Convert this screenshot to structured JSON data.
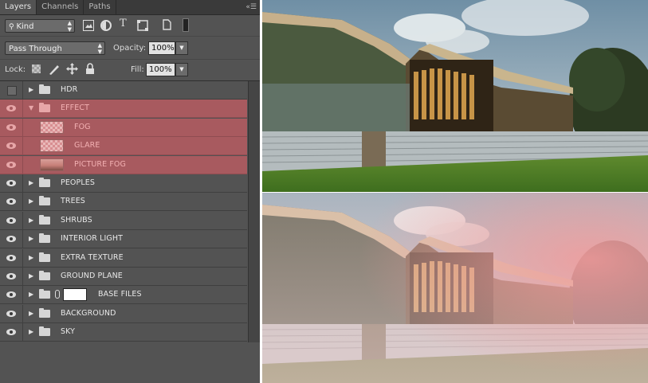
{
  "tabs": [
    {
      "label": "Layers",
      "active": true
    },
    {
      "label": "Channels",
      "active": false
    },
    {
      "label": "Paths",
      "active": false
    }
  ],
  "filter": {
    "kind_label": "Kind",
    "icons": [
      "image-filter-icon",
      "adjustment-filter-icon",
      "type-filter-icon",
      "shape-filter-icon",
      "smart-object-filter-icon",
      "filter-toggle-icon"
    ]
  },
  "blend": {
    "mode": "Pass Through",
    "opacity_label": "Opacity:",
    "opacity_value": "100%"
  },
  "lock": {
    "label": "Lock:",
    "icons": [
      "lock-transparent-icon",
      "lock-paint-icon",
      "lock-position-icon",
      "lock-all-icon"
    ],
    "fill_label": "Fill:",
    "fill_value": "100%"
  },
  "layers": [
    {
      "name": "HDR",
      "type": "group",
      "visible": false,
      "highlight": false,
      "depth": 0
    },
    {
      "name": "EFFECT",
      "type": "group",
      "visible": true,
      "highlight": true,
      "expanded": true,
      "depth": 0
    },
    {
      "name": "FOG",
      "type": "layer",
      "visible": true,
      "highlight": true,
      "thumb": "checker",
      "depth": 1
    },
    {
      "name": "GLARE",
      "type": "layer",
      "visible": true,
      "highlight": true,
      "thumb": "checker",
      "depth": 1
    },
    {
      "name": "PICTURE FOG",
      "type": "layer",
      "visible": true,
      "highlight": true,
      "thumb": "image",
      "depth": 1
    },
    {
      "name": "PEOPLES",
      "type": "group",
      "visible": true,
      "highlight": false,
      "depth": 0
    },
    {
      "name": "TREES",
      "type": "group",
      "visible": true,
      "highlight": false,
      "depth": 0
    },
    {
      "name": "SHRUBS",
      "type": "group",
      "visible": true,
      "highlight": false,
      "depth": 0
    },
    {
      "name": "INTERIOR LIGHT",
      "type": "group",
      "visible": true,
      "highlight": false,
      "depth": 0
    },
    {
      "name": "EXTRA TEXTURE",
      "type": "group",
      "visible": true,
      "highlight": false,
      "depth": 0
    },
    {
      "name": "GROUND PLANE",
      "type": "group",
      "visible": true,
      "highlight": false,
      "depth": 0
    },
    {
      "name": "BASE FILES",
      "type": "group",
      "visible": true,
      "highlight": false,
      "mask": true,
      "depth": 0
    },
    {
      "name": "BACKGROUND",
      "type": "group",
      "visible": true,
      "highlight": false,
      "depth": 0
    },
    {
      "name": "SKY",
      "type": "group",
      "visible": true,
      "highlight": false,
      "depth": 0
    }
  ],
  "colors": {
    "panel_bg": "#535353",
    "highlight_red": "#a85a5f",
    "highlight_text": "#f2b0b2"
  }
}
